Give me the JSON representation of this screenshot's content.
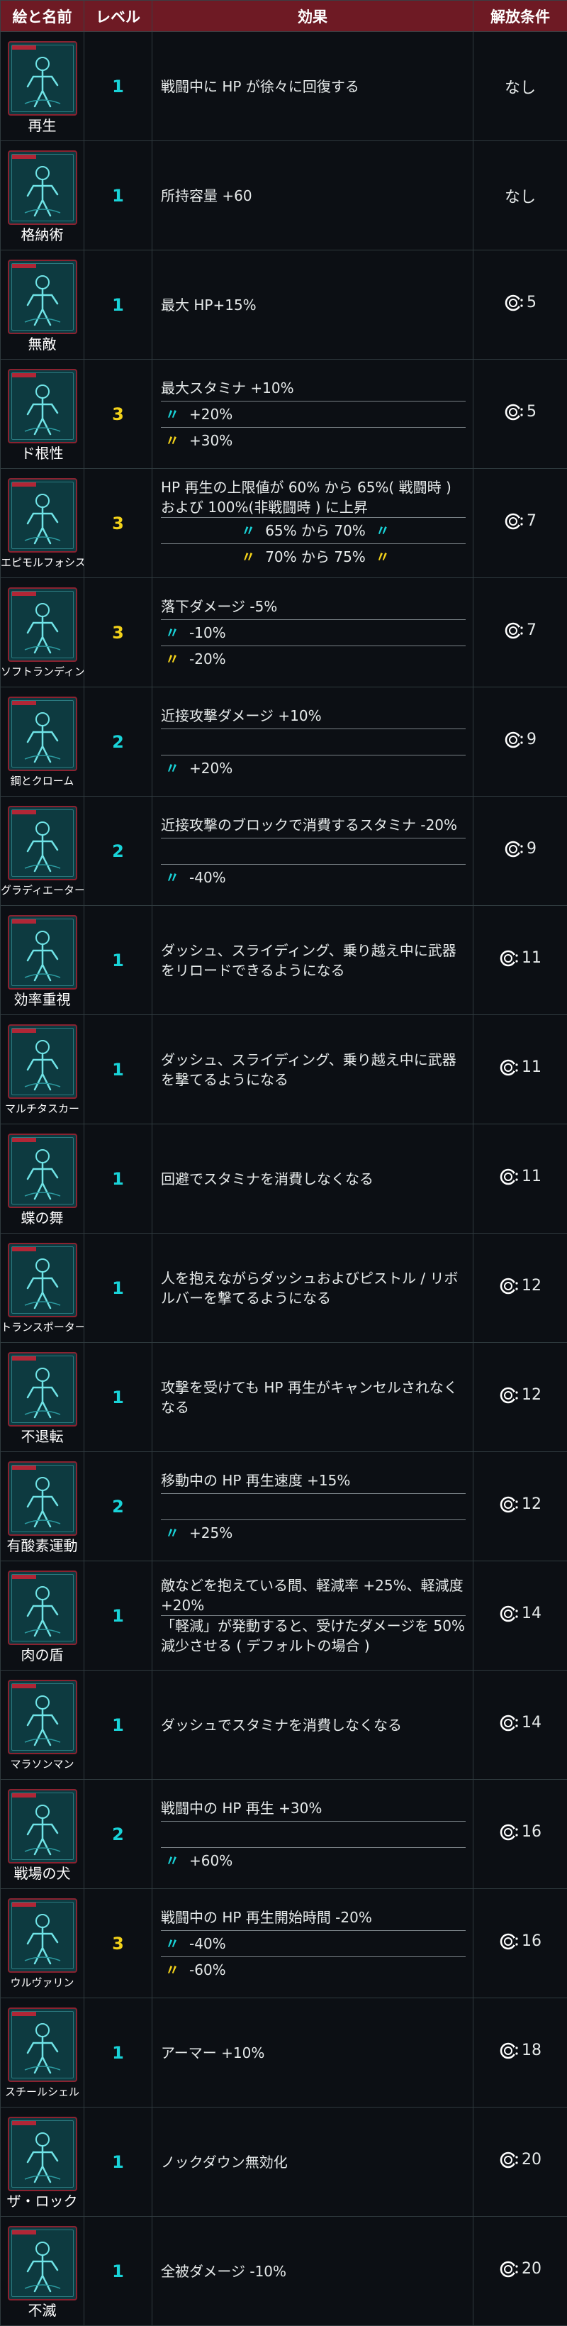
{
  "header": {
    "col_icon": "絵と名前",
    "col_level": "レベル",
    "col_effect": "効果",
    "col_unlock": "解放条件"
  },
  "colors": {
    "header_bg": "#6e1a24",
    "level_cyan": "#19d3d8",
    "level_yellow": "#f3d21a",
    "card_border": "#8a2230"
  },
  "perks": [
    {
      "name": "再生",
      "level": "1",
      "level_color": "cyan",
      "unlock": "なし",
      "effects": [
        {
          "text": "戦闘中に HP が徐々に回復する"
        }
      ]
    },
    {
      "name": "格納術",
      "level": "1",
      "level_color": "cyan",
      "unlock": "なし",
      "effects": [
        {
          "text": "所持容量 +60"
        }
      ]
    },
    {
      "name": "無敵",
      "level": "1",
      "level_color": "cyan",
      "unlock": "5",
      "effects": [
        {
          "text": "最大 HP+15%"
        }
      ]
    },
    {
      "name": "ド根性",
      "level": "3",
      "level_color": "yellow",
      "unlock": "5",
      "effects": [
        {
          "text": "最大スタミナ +10%"
        },
        {
          "ditto": "cyan",
          "text": "+20%"
        },
        {
          "ditto": "yellow",
          "text": "+30%"
        }
      ]
    },
    {
      "name": "エピモルフォシス",
      "level": "3",
      "level_color": "yellow",
      "unlock": "7",
      "effects": [
        {
          "text": "HP 再生の上限値が 60% から 65%( 戦闘時 ) および 100%(非戦闘時 ) に上昇"
        },
        {
          "ditto_both": "cyan",
          "text": "65% から 70%"
        },
        {
          "ditto_both": "yellow",
          "text": "70% から 75%"
        }
      ]
    },
    {
      "name": "ソフトランディング",
      "level": "3",
      "level_color": "yellow",
      "unlock": "7",
      "effects": [
        {
          "text": "落下ダメージ -5%"
        },
        {
          "ditto": "cyan",
          "text": "-10%"
        },
        {
          "ditto": "yellow",
          "text": "-20%"
        }
      ]
    },
    {
      "name": "鋼とクローム",
      "level": "2",
      "level_color": "cyan",
      "unlock": "9",
      "effects": [
        {
          "text": "近接攻撃ダメージ +10%"
        },
        {
          "blank": true
        },
        {
          "ditto": "cyan",
          "text": "+20%"
        }
      ]
    },
    {
      "name": "グラディエーター",
      "level": "2",
      "level_color": "cyan",
      "unlock": "9",
      "effects": [
        {
          "text": "近接攻撃のブロックで消費するスタミナ -20%"
        },
        {
          "blank": true
        },
        {
          "ditto": "cyan",
          "text": "-40%"
        }
      ]
    },
    {
      "name": "効率重視",
      "level": "1",
      "level_color": "cyan",
      "unlock": "11",
      "effects": [
        {
          "text": "ダッシュ、スライディング、乗り越え中に武器をリロードできるようになる"
        }
      ]
    },
    {
      "name": "マルチタスカー",
      "level": "1",
      "level_color": "cyan",
      "unlock": "11",
      "effects": [
        {
          "text": "ダッシュ、スライディング、乗り越え中に武器を撃てるようになる"
        }
      ]
    },
    {
      "name": "蝶の舞",
      "level": "1",
      "level_color": "cyan",
      "unlock": "11",
      "effects": [
        {
          "text": "回避でスタミナを消費しなくなる"
        }
      ]
    },
    {
      "name": "トランスポーター",
      "level": "1",
      "level_color": "cyan",
      "unlock": "12",
      "effects": [
        {
          "text": "人を抱えながらダッシュおよびピストル / リボルバーを撃てるようになる"
        }
      ]
    },
    {
      "name": "不退転",
      "level": "1",
      "level_color": "cyan",
      "unlock": "12",
      "effects": [
        {
          "text": "攻撃を受けても HP 再生がキャンセルされなくなる"
        }
      ]
    },
    {
      "name": "有酸素運動",
      "level": "2",
      "level_color": "cyan",
      "unlock": "12",
      "effects": [
        {
          "text": "移動中の HP 再生速度 +15%"
        },
        {
          "blank": true
        },
        {
          "ditto": "cyan",
          "text": "+25%"
        }
      ]
    },
    {
      "name": "肉の盾",
      "level": "1",
      "level_color": "cyan",
      "unlock": "14",
      "effects": [
        {
          "text": "敵などを抱えている間、軽減率 +25%、軽減度 +20%"
        },
        {
          "text": "「軽減」が発動すると、受けたダメージを 50% 減少させる ( デフォルトの場合 )"
        }
      ]
    },
    {
      "name": "マラソンマン",
      "level": "1",
      "level_color": "cyan",
      "unlock": "14",
      "effects": [
        {
          "text": "ダッシュでスタミナを消費しなくなる"
        }
      ]
    },
    {
      "name": "戦場の犬",
      "level": "2",
      "level_color": "cyan",
      "unlock": "16",
      "effects": [
        {
          "text": "戦闘中の HP 再生 +30%"
        },
        {
          "blank": true
        },
        {
          "ditto": "cyan",
          "text": "+60%"
        }
      ]
    },
    {
      "name": "ウルヴァリン",
      "level": "3",
      "level_color": "yellow",
      "unlock": "16",
      "effects": [
        {
          "text": "戦闘中の HP 再生開始時間 -20%"
        },
        {
          "ditto": "cyan",
          "text": "-40%"
        },
        {
          "ditto": "yellow",
          "text": "-60%"
        }
      ]
    },
    {
      "name": "スチールシェル",
      "level": "1",
      "level_color": "cyan",
      "unlock": "18",
      "effects": [
        {
          "text": "アーマー +10%"
        }
      ]
    },
    {
      "name": "ザ・ロック",
      "level": "1",
      "level_color": "cyan",
      "unlock": "20",
      "effects": [
        {
          "text": "ノックダウン無効化"
        }
      ]
    },
    {
      "name": "不滅",
      "level": "1",
      "level_color": "cyan",
      "unlock": "20",
      "effects": [
        {
          "text": "全被ダメージ -10%"
        }
      ]
    }
  ]
}
